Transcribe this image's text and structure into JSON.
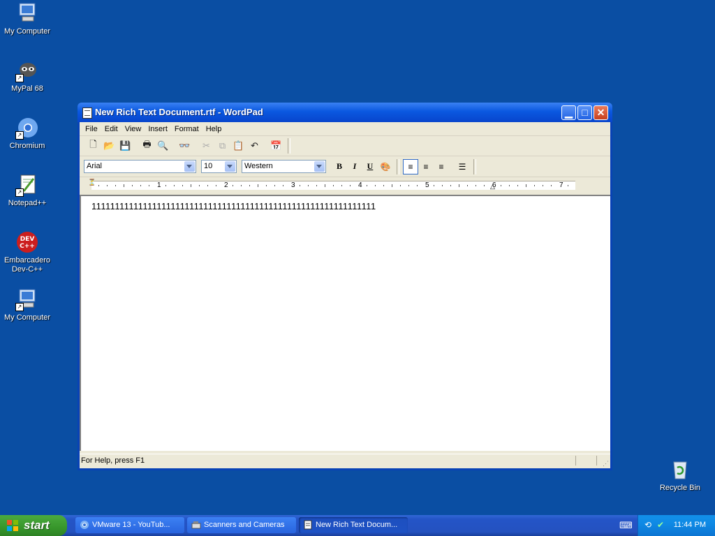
{
  "desktop": {
    "icons": [
      {
        "label": "My Computer"
      },
      {
        "label": "MyPal 68"
      },
      {
        "label": "Chromium"
      },
      {
        "label": "Notepad++"
      },
      {
        "label_line1": "Embarcadero",
        "label_line2": "Dev-C++"
      },
      {
        "label": "My Computer"
      },
      {
        "label": "Recycle Bin"
      }
    ]
  },
  "window": {
    "title": "New Rich Text Document.rtf - WordPad",
    "menu": [
      "File",
      "Edit",
      "View",
      "Insert",
      "Format",
      "Help"
    ],
    "format": {
      "font": "Arial",
      "size": "10",
      "script": "Western",
      "bold_label": "B",
      "italic_label": "I",
      "underline_label": "U"
    },
    "ruler_numbers": [
      "1",
      "2",
      "3",
      "4",
      "5",
      "6",
      "7"
    ],
    "document_text": "1111111111111111111111111111111111111111111111111111111111111",
    "status": "For Help, press F1"
  },
  "taskbar": {
    "start_label": "start",
    "tasks": [
      {
        "label": "VMware 13 - YouTub..."
      },
      {
        "label": "Scanners and Cameras"
      },
      {
        "label": "New Rich Text Docum..."
      }
    ],
    "clock": "11:44 PM"
  }
}
